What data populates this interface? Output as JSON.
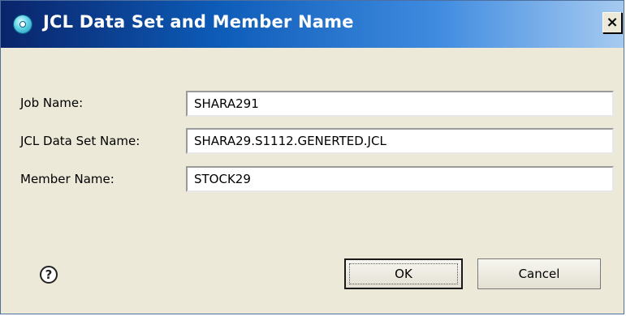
{
  "window": {
    "title": "JCL Data Set and Member Name",
    "close_glyph": "×"
  },
  "form": {
    "job_name": {
      "label": "Job Name:",
      "value": "SHARA291"
    },
    "jcl_data_set_name": {
      "label": "JCL Data Set Name:",
      "value": "SHARA29.S1112.GENERTED.JCL"
    },
    "member_name": {
      "label": "Member Name:",
      "value": "STOCK29"
    }
  },
  "footer": {
    "help_glyph": "?",
    "ok_label": "OK",
    "cancel_label": "Cancel"
  },
  "icons": {
    "title": "dialog-app-icon",
    "help": "help-icon",
    "close": "close-icon"
  }
}
